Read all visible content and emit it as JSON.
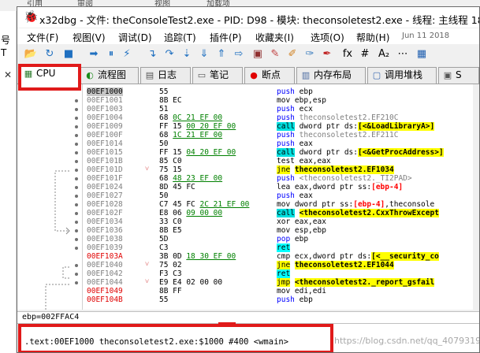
{
  "background": {
    "top_menu_fragments": [
      "引用",
      "审阅",
      "视图",
      "加载项"
    ],
    "left_panel_lines": [
      "号",
      "T"
    ],
    "left_close": "✕"
  },
  "window": {
    "title": "x32dbg - 文件: theConsoleTest2.exe - PID: D98 - 模块: theconsoletest2.exe - 线程: 主线程 18E0"
  },
  "menu": {
    "items": [
      "文件(F)",
      "视图(V)",
      "调试(D)",
      "追踪(T)",
      "插件(P)",
      "收藏夹(I)",
      "选项(O)",
      "帮助(H)"
    ],
    "date": "Jun 11 2018"
  },
  "toolbar_icons": [
    {
      "name": "open-icon",
      "glyph": "📂",
      "color": "#c8a040"
    },
    {
      "name": "restart-icon",
      "glyph": "↻",
      "color": "#2070c0"
    },
    {
      "name": "close-icon",
      "glyph": "■",
      "color": "#2070c0"
    },
    {
      "name": "run-icon",
      "glyph": "➡",
      "color": "#2070c0"
    },
    {
      "name": "pause-icon",
      "glyph": "⏸",
      "color": "#2070c0"
    },
    {
      "name": "animate-icon",
      "glyph": "⚡",
      "color": "#2070c0"
    },
    {
      "name": "step-into-icon",
      "glyph": "↴",
      "color": "#2070c0"
    },
    {
      "name": "step-over-icon",
      "glyph": "↷",
      "color": "#2070c0"
    },
    {
      "name": "trace-into-icon",
      "glyph": "⇣",
      "color": "#2070c0"
    },
    {
      "name": "trace-over-icon",
      "glyph": "⇓",
      "color": "#2070c0"
    },
    {
      "name": "execute-till-return-icon",
      "glyph": "⇑",
      "color": "#2070c0"
    },
    {
      "name": "run-to-user-code-icon",
      "glyph": "⇨",
      "color": "#2070c0"
    },
    {
      "name": "scylla-icon",
      "glyph": "▣",
      "color": "#903030"
    },
    {
      "name": "patch-icon",
      "glyph": "✎",
      "color": "#c04040"
    },
    {
      "name": "comment-icon",
      "glyph": "✐",
      "color": "#d08020"
    },
    {
      "name": "label-icon",
      "glyph": "✑",
      "color": "#4080c0"
    },
    {
      "name": "bookmark-icon",
      "glyph": "✒",
      "color": "#c02020"
    },
    {
      "name": "function-icon",
      "glyph": "fx",
      "color": "#000000"
    },
    {
      "name": "hash-icon",
      "glyph": "#",
      "color": "#000000"
    },
    {
      "name": "cmd-icon",
      "glyph": "A₂",
      "color": "#000000"
    },
    {
      "name": "strings-icon",
      "glyph": "⋯",
      "color": "#000000"
    },
    {
      "name": "calculator-icon",
      "glyph": "▦",
      "color": "#2060b0"
    }
  ],
  "tabs": [
    {
      "label": "CPU",
      "icon": "▦",
      "icon_name": "cpu-icon"
    },
    {
      "label": "流程图",
      "icon": "◐",
      "icon_name": "graph-icon"
    },
    {
      "label": "日志",
      "icon": "▤",
      "icon_name": "log-icon"
    },
    {
      "label": "笔记",
      "icon": "▭",
      "icon_name": "notes-icon"
    },
    {
      "label": "断点",
      "icon": "●",
      "icon_name": "breakpoint-icon"
    },
    {
      "label": "内存布局",
      "icon": "▥",
      "icon_name": "memory-map-icon"
    },
    {
      "label": "调用堆栈",
      "icon": "▢",
      "icon_name": "call-stack-icon"
    },
    {
      "label": "S",
      "icon": "▣",
      "icon_name": "seh-icon"
    }
  ],
  "disassembly": [
    {
      "addr": "00EF1000",
      "addr_style": "hl",
      "bytes": [
        "55"
      ],
      "asm": [
        [
          "push",
          "push"
        ],
        [
          "sp",
          " "
        ],
        [
          "n",
          "ebp"
        ]
      ],
      "dot": false
    },
    {
      "addr": "00EF1001",
      "bytes": [
        "8B EC"
      ],
      "asm": [
        [
          "plain",
          "mov ebp,esp"
        ]
      ],
      "dot": true
    },
    {
      "addr": "00EF1003",
      "bytes": [
        "51"
      ],
      "asm": [
        [
          "push",
          "push"
        ],
        [
          "sp",
          " "
        ],
        [
          "n",
          "ecx"
        ]
      ],
      "dot": true
    },
    {
      "addr": "00EF1004",
      "bytes": [
        "68 ",
        "u:0C 21 EF 00"
      ],
      "asm": [
        [
          "push",
          "push"
        ],
        [
          "sp",
          " "
        ],
        [
          "grey",
          "theconsoletest2.EF210C"
        ]
      ],
      "dot": true
    },
    {
      "addr": "00EF1009",
      "bytes": [
        "FF 15 ",
        "u:00 20 EF 00"
      ],
      "asm": [
        [
          "call",
          "call"
        ],
        [
          "sp",
          " "
        ],
        [
          "n",
          "dword ptr ds:"
        ],
        [
          "label",
          "[<&LoadLibraryA>]"
        ]
      ],
      "dot": true
    },
    {
      "addr": "00EF100F",
      "bytes": [
        "68 ",
        "u:1C 21 EF 00"
      ],
      "asm": [
        [
          "push",
          "push"
        ],
        [
          "sp",
          " "
        ],
        [
          "grey",
          "theconsoletest2.EF211C"
        ]
      ],
      "dot": true
    },
    {
      "addr": "00EF1014",
      "bytes": [
        "50"
      ],
      "asm": [
        [
          "push",
          "push"
        ],
        [
          "sp",
          " "
        ],
        [
          "n",
          "eax"
        ]
      ],
      "dot": true
    },
    {
      "addr": "00EF1015",
      "bytes": [
        "FF 15 ",
        "u:04 20 EF 00"
      ],
      "asm": [
        [
          "call",
          "call"
        ],
        [
          "sp",
          " "
        ],
        [
          "n",
          "dword ptr ds:"
        ],
        [
          "label",
          "[<&GetProcAddress>]"
        ]
      ],
      "dot": true
    },
    {
      "addr": "00EF101B",
      "bytes": [
        "85 C0"
      ],
      "asm": [
        [
          "plain",
          "test eax,eax"
        ]
      ],
      "dot": true
    },
    {
      "addr": "00EF101D",
      "arrow": "˅",
      "bytes": [
        "75 15"
      ],
      "asm": [
        [
          "jmp",
          "jne"
        ],
        [
          "sp",
          " "
        ],
        [
          "target",
          "theconsoletest2.EF1034"
        ]
      ],
      "dot": true
    },
    {
      "addr": "00EF101F",
      "bytes": [
        "68 ",
        "u:48 23 EF 00"
      ],
      "asm": [
        [
          "push",
          "push"
        ],
        [
          "sp",
          " "
        ],
        [
          "grey",
          "<theconsoletest2._TI2PAD>"
        ]
      ],
      "dot": true
    },
    {
      "addr": "00EF1024",
      "bytes": [
        "8D 45 FC"
      ],
      "asm": [
        [
          "plain",
          "lea eax,dword ptr ss:"
        ],
        [
          "brk",
          "[ebp-4]"
        ]
      ],
      "dot": true
    },
    {
      "addr": "00EF1027",
      "bytes": [
        "50"
      ],
      "asm": [
        [
          "push",
          "push"
        ],
        [
          "sp",
          " "
        ],
        [
          "n",
          "eax"
        ]
      ],
      "dot": true
    },
    {
      "addr": "00EF1028",
      "bytes": [
        "C7 45 FC ",
        "u:2C 21 EF 00"
      ],
      "asm": [
        [
          "plain",
          "mov dword ptr ss:"
        ],
        [
          "brk",
          "[ebp-4]"
        ],
        [
          "n",
          ",theconsole"
        ]
      ],
      "dot": true
    },
    {
      "addr": "00EF102F",
      "bytes": [
        "E8 06 ",
        "u:09 00 00"
      ],
      "asm": [
        [
          "call",
          "call"
        ],
        [
          "sp",
          " "
        ],
        [
          "target",
          "<theconsoletest2.CxxThrowExcept"
        ]
      ],
      "dot": true
    },
    {
      "addr": "00EF1034",
      "bytes": [
        "33 C0"
      ],
      "asm": [
        [
          "plain",
          "xor eax,eax"
        ]
      ],
      "dot": true
    },
    {
      "addr": "00EF1036",
      "bytes": [
        "8B E5"
      ],
      "asm": [
        [
          "plain",
          "mov esp,ebp"
        ]
      ],
      "dot": true
    },
    {
      "addr": "00EF1038",
      "bytes": [
        "5D"
      ],
      "asm": [
        [
          "push",
          "pop"
        ],
        [
          "sp",
          " "
        ],
        [
          "n",
          "ebp"
        ]
      ],
      "dot": true
    },
    {
      "addr": "00EF1039",
      "bytes": [
        "C3"
      ],
      "asm": [
        [
          "ret",
          "ret"
        ]
      ],
      "dot": true
    },
    {
      "addr": "00EF103A",
      "addr_style": "red",
      "bytes": [
        "3B 0D ",
        "u:18 30 EF 00"
      ],
      "asm": [
        [
          "cmp",
          "cmp ecx,dword ptr ds:"
        ],
        [
          "label",
          "[<__security_co"
        ]
      ],
      "dot": false
    },
    {
      "addr": "00EF1040",
      "arrow": "˅",
      "bytes": [
        "75 02"
      ],
      "asm": [
        [
          "jmp",
          "jne"
        ],
        [
          "sp",
          " "
        ],
        [
          "target",
          "theconsoletest2.EF1044"
        ]
      ],
      "dot": true
    },
    {
      "addr": "00EF1042",
      "bytes": [
        "F3 C3"
      ],
      "asm": [
        [
          "ret",
          "ret"
        ]
      ],
      "dot": true
    },
    {
      "addr": "00EF1044",
      "arrow": "˅",
      "bytes": [
        "E9 E4 02 00 00"
      ],
      "asm": [
        [
          "jmp",
          "jmp"
        ],
        [
          "sp",
          " "
        ],
        [
          "target",
          "<theconsoletest2._report_gsfail"
        ]
      ],
      "dot": true
    },
    {
      "addr": "00EF1049",
      "addr_style": "red",
      "bytes": [
        "8B FF"
      ],
      "asm": [
        [
          "plain",
          "mov edi,edi"
        ]
      ],
      "dot": false
    },
    {
      "addr": "00EF104B",
      "addr_style": "red",
      "bytes": [
        "55"
      ],
      "asm": [
        [
          "push",
          "push"
        ],
        [
          "sp",
          " "
        ],
        [
          "n",
          "ebp"
        ]
      ],
      "dot": false
    }
  ],
  "status": {
    "register": "ebp=002FFAC4",
    "info": ".text:00EF1000 theconsoletest2.exe:$1000 #400 <wmain>"
  },
  "watermark": "https://blog.csdn.net/qq_40793198"
}
